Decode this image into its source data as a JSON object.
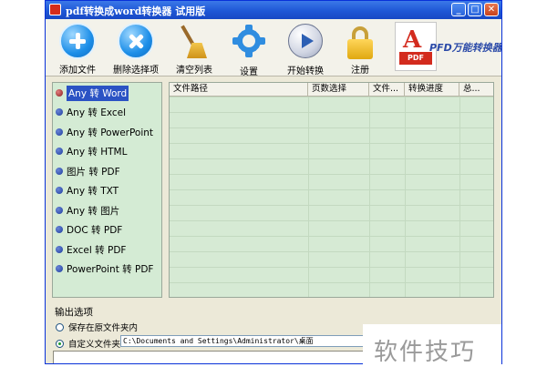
{
  "window": {
    "title": "pdf转换成word转换器 试用版",
    "controls": {
      "minimize": "_",
      "maximize": "□",
      "close": "✕"
    }
  },
  "toolbar": {
    "items": [
      {
        "label": "添加文件",
        "icon": "add-icon"
      },
      {
        "label": "删除选择项",
        "icon": "delete-icon"
      },
      {
        "label": "清空列表",
        "icon": "broom-icon"
      },
      {
        "label": "设置",
        "icon": "gear-icon"
      },
      {
        "label": "开始转换",
        "icon": "play-icon"
      },
      {
        "label": "注册",
        "icon": "lock-icon"
      }
    ],
    "logo": {
      "glyph": "A",
      "tag": "PDF",
      "brand": "PFD万能转换器"
    }
  },
  "modes": {
    "selected_index": 0,
    "items": [
      "Any 转 Word",
      "Any 转 Excel",
      "Any 转 PowerPoint",
      "Any 转 HTML",
      "图片 转 PDF",
      "Any 转 TXT",
      "Any 转 图片",
      "DOC 转 PDF",
      "Excel 转 PDF",
      "PowerPoint 转 PDF"
    ]
  },
  "file_table": {
    "columns": [
      "文件路径",
      "页数选择",
      "文件...",
      "转换进度",
      "总..."
    ],
    "rows": []
  },
  "output": {
    "section_title": "输出选项",
    "option_original": "保存在原文件夹内",
    "option_custom": "自定义文件夹",
    "selected": "custom",
    "custom_path": "C:\\Documents and Settings\\Administrator\\桌面"
  },
  "watermark": {
    "text": "软件技巧"
  },
  "colors": {
    "titlebar": "#1f57d6",
    "list_bg": "#d4ebd4",
    "selection": "#2b53c4"
  }
}
